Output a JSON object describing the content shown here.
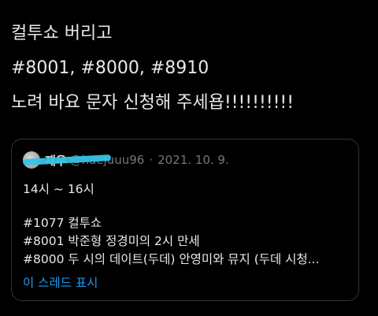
{
  "tweet": {
    "lines": [
      "컬투쇼 버리고",
      "#8001, #8000, #8910",
      "노려 바요 문자 신청해 주세욥!!!!!!!!!!"
    ]
  },
  "quoted_tweet": {
    "display_name": "재우",
    "handle": "@haejuuu96",
    "separator": "·",
    "date": "2021. 10. 9.",
    "body": {
      "time_range": "14시 ~ 16시",
      "items": [
        "#1077 컬투쇼",
        "#8001 박준형 정경미의 2시 만세",
        "#8000 두 시의 데이트(두데) 안영미와 뮤지 (두데 시청..."
      ]
    },
    "show_thread_label": "이 스레드 표시"
  },
  "colors": {
    "background": "#000000",
    "text": "#e7e9ea",
    "muted": "#71767b",
    "link": "#1d9bf0",
    "redaction_marker": "#35c3e6"
  },
  "icons": {
    "avatar": "profile-avatar"
  }
}
